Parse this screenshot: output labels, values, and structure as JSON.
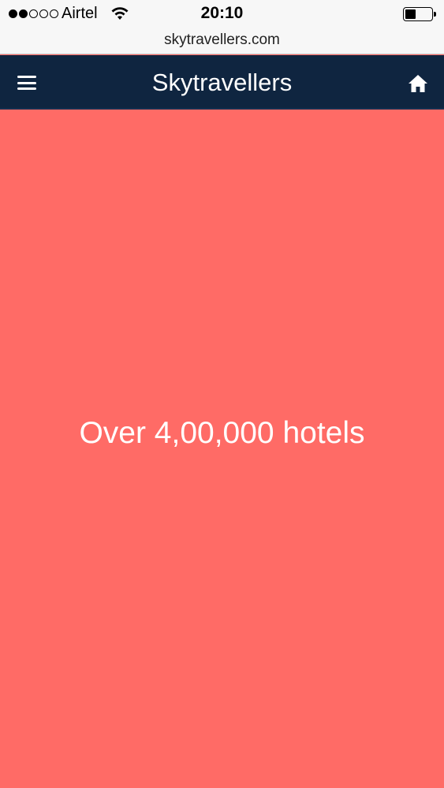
{
  "status_bar": {
    "carrier": "Airtel",
    "time": "20:10",
    "signal_bars_filled": 2,
    "signal_bars_total": 5,
    "battery_level": 0.35
  },
  "browser": {
    "url": "skytravellers.com"
  },
  "header": {
    "title": "Skytravellers",
    "menu_icon": "hamburger-menu-icon",
    "home_icon": "home-icon",
    "background_color": "#0f2540"
  },
  "hero": {
    "text": "Over 4,00,000 hotels",
    "background_color": "#ff6b66"
  }
}
